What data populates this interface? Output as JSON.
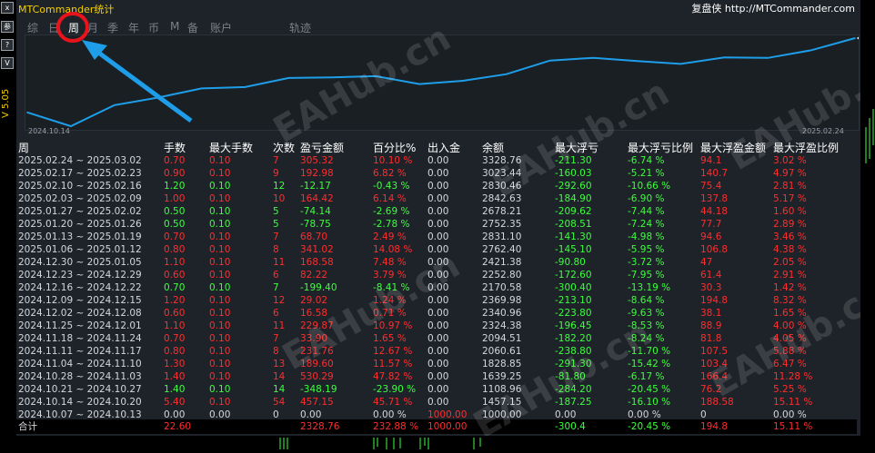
{
  "app_title": "MTCommander统计",
  "brand": "复盘侠 http://MTCommander.com",
  "version": "V 5.05",
  "toolbar_buttons": [
    "x",
    "参",
    "?",
    "V"
  ],
  "tabs": [
    "综",
    "日",
    "周",
    "月",
    "季",
    "年",
    "币",
    "M",
    "备",
    "账户",
    "轨迹"
  ],
  "active_tab": "周",
  "chart": {
    "start_date": "2024.10.14",
    "end_date": "2025.02.24",
    "line_color": "#1e9ee8"
  },
  "chart_data": {
    "type": "line",
    "x": [
      "2024.10.14",
      "2024.10.21",
      "2024.10.28",
      "2024.11.04",
      "2024.11.11",
      "2024.11.18",
      "2024.11.25",
      "2024.12.02",
      "2024.12.09",
      "2024.12.16",
      "2024.12.23",
      "2024.12.30",
      "2025.01.06",
      "2025.01.13",
      "2025.01.20",
      "2025.01.27",
      "2025.02.03",
      "2025.02.10",
      "2025.02.17",
      "2025.02.24"
    ],
    "series": [
      {
        "values": [
          1457.15,
          1108.96,
          1639.25,
          1828.85,
          2060.61,
          2094.51,
          2324.38,
          2340.96,
          2369.98,
          2170.58,
          2252.8,
          2421.38,
          2762.4,
          2831.1,
          2752.35,
          2678.21,
          2842.63,
          2830.46,
          3023.44,
          3328.76
        ]
      }
    ]
  },
  "table": {
    "headers": [
      "周",
      "手数",
      "最大手数",
      "次数",
      "盈亏金额",
      "百分比%",
      "出入金",
      "余额",
      "最大浮亏",
      "最大浮亏比例",
      "最大浮盈金额",
      "最大浮盈比例"
    ],
    "rows": [
      {
        "c": [
          "2025.02.24 ~ 2025.03.02",
          "0.70",
          "0.10",
          "7",
          "305.32",
          "10.10 %",
          "0.00",
          "3328.76",
          "-211.30",
          "-6.74 %",
          "94.1",
          "3.02 %"
        ],
        "pnl": "pos"
      },
      {
        "c": [
          "2025.02.17 ~ 2025.02.23",
          "0.90",
          "0.10",
          "9",
          "192.98",
          "6.82 %",
          "0.00",
          "3023.44",
          "-160.03",
          "-5.21 %",
          "140.7",
          "4.97 %"
        ],
        "pnl": "pos"
      },
      {
        "c": [
          "2025.02.10 ~ 2025.02.16",
          "1.20",
          "0.10",
          "12",
          "-12.17",
          "-0.43 %",
          "0.00",
          "2830.46",
          "-292.60",
          "-10.66 %",
          "75.4",
          "2.81 %"
        ],
        "pnl": "neg"
      },
      {
        "c": [
          "2025.02.03 ~ 2025.02.09",
          "1.00",
          "0.10",
          "10",
          "164.42",
          "6.14 %",
          "0.00",
          "2842.63",
          "-184.90",
          "-6.90 %",
          "137.8",
          "5.17 %"
        ],
        "pnl": "pos"
      },
      {
        "c": [
          "2025.01.27 ~ 2025.02.02",
          "0.50",
          "0.10",
          "5",
          "-74.14",
          "-2.69 %",
          "0.00",
          "2678.21",
          "-209.62",
          "-7.44 %",
          "44.18",
          "1.60 %"
        ],
        "pnl": "neg"
      },
      {
        "c": [
          "2025.01.20 ~ 2025.01.26",
          "0.50",
          "0.10",
          "5",
          "-78.75",
          "-2.78 %",
          "0.00",
          "2752.35",
          "-208.51",
          "-7.24 %",
          "77.7",
          "2.89 %"
        ],
        "pnl": "neg"
      },
      {
        "c": [
          "2025.01.13 ~ 2025.01.19",
          "0.70",
          "0.10",
          "7",
          "68.70",
          "2.49 %",
          "0.00",
          "2831.10",
          "-141.30",
          "-4.98 %",
          "94.6",
          "3.46 %"
        ],
        "pnl": "pos"
      },
      {
        "c": [
          "2025.01.06 ~ 2025.01.12",
          "0.80",
          "0.10",
          "8",
          "341.02",
          "14.08 %",
          "0.00",
          "2762.40",
          "-145.10",
          "-5.95 %",
          "106.8",
          "4.38 %"
        ],
        "pnl": "pos"
      },
      {
        "c": [
          "2024.12.30 ~ 2025.01.05",
          "1.10",
          "0.10",
          "11",
          "168.58",
          "7.48 %",
          "0.00",
          "2421.38",
          "-90.80",
          "-3.72 %",
          "47",
          "2.05 %"
        ],
        "pnl": "pos"
      },
      {
        "c": [
          "2024.12.23 ~ 2024.12.29",
          "0.60",
          "0.10",
          "6",
          "82.22",
          "3.79 %",
          "0.00",
          "2252.80",
          "-172.60",
          "-7.95 %",
          "61.4",
          "2.91 %"
        ],
        "pnl": "pos"
      },
      {
        "c": [
          "2024.12.16 ~ 2024.12.22",
          "0.70",
          "0.10",
          "7",
          "-199.40",
          "-8.41 %",
          "0.00",
          "2170.58",
          "-300.40",
          "-13.19 %",
          "30.3",
          "1.42 %"
        ],
        "pnl": "neg"
      },
      {
        "c": [
          "2024.12.09 ~ 2024.12.15",
          "1.20",
          "0.10",
          "12",
          "29.02",
          "1.24 %",
          "0.00",
          "2369.98",
          "-213.10",
          "-8.64 %",
          "194.8",
          "8.32 %"
        ],
        "pnl": "pos"
      },
      {
        "c": [
          "2024.12.02 ~ 2024.12.08",
          "0.60",
          "0.10",
          "6",
          "16.58",
          "0.71 %",
          "0.00",
          "2340.96",
          "-223.80",
          "-9.63 %",
          "38.1",
          "1.65 %"
        ],
        "pnl": "pos"
      },
      {
        "c": [
          "2024.11.25 ~ 2024.12.01",
          "1.10",
          "0.10",
          "11",
          "229.87",
          "10.97 %",
          "0.00",
          "2324.38",
          "-196.45",
          "-8.53 %",
          "88.9",
          "4.00 %"
        ],
        "pnl": "pos"
      },
      {
        "c": [
          "2024.11.18 ~ 2024.11.24",
          "0.70",
          "0.10",
          "7",
          "33.90",
          "1.65 %",
          "0.00",
          "2094.51",
          "-182.20",
          "-8.24 %",
          "81.8",
          "4.05 %"
        ],
        "pnl": "pos"
      },
      {
        "c": [
          "2024.11.11 ~ 2024.11.17",
          "0.80",
          "0.10",
          "8",
          "231.76",
          "12.67 %",
          "0.00",
          "2060.61",
          "-238.80",
          "-11.70 %",
          "107.5",
          "5.88 %"
        ],
        "pnl": "pos"
      },
      {
        "c": [
          "2024.11.04 ~ 2024.11.10",
          "1.30",
          "0.10",
          "13",
          "189.60",
          "11.57 %",
          "0.00",
          "1828.85",
          "-291.30",
          "-15.42 %",
          "103.4",
          "6.47 %"
        ],
        "pnl": "pos"
      },
      {
        "c": [
          "2024.10.28 ~ 2024.11.03",
          "1.40",
          "0.10",
          "14",
          "530.29",
          "47.82 %",
          "0.00",
          "1639.25",
          "-81.80",
          "-6.17 %",
          "166.4",
          "11.28 %"
        ],
        "pnl": "pos"
      },
      {
        "c": [
          "2024.10.21 ~ 2024.10.27",
          "1.40",
          "0.10",
          "14",
          "-348.19",
          "-23.90 %",
          "0.00",
          "1108.96",
          "-284.20",
          "-20.45 %",
          "76.2",
          "5.25 %"
        ],
        "pnl": "neg"
      },
      {
        "c": [
          "2024.10.14 ~ 2024.10.20",
          "5.40",
          "0.10",
          "54",
          "457.15",
          "45.71 %",
          "0.00",
          "1457.15",
          "-187.25",
          "-16.10 %",
          "188.58",
          "15.11 %"
        ],
        "pnl": "pos"
      },
      {
        "c": [
          "2024.10.07 ~ 2024.10.13",
          "0.00",
          "0.00",
          "0",
          "0.00",
          "0.00 %",
          "1000.00",
          "1000.00",
          "0.00",
          "0.00 %",
          "0",
          "0.00 %"
        ],
        "pnl": "zero"
      }
    ],
    "total": [
      "合计",
      "22.60",
      "",
      "",
      "2328.76",
      "232.88 %",
      "1000.00",
      "",
      "-300.4",
      "-20.45 %",
      "194.8",
      "15.11 %"
    ]
  },
  "watermark": "EAHub.cn",
  "colors": {
    "positive": "#ff2d2d",
    "negative": "#3cff3c",
    "highlight": "#e8141c",
    "arrow": "#1e9ee8"
  }
}
